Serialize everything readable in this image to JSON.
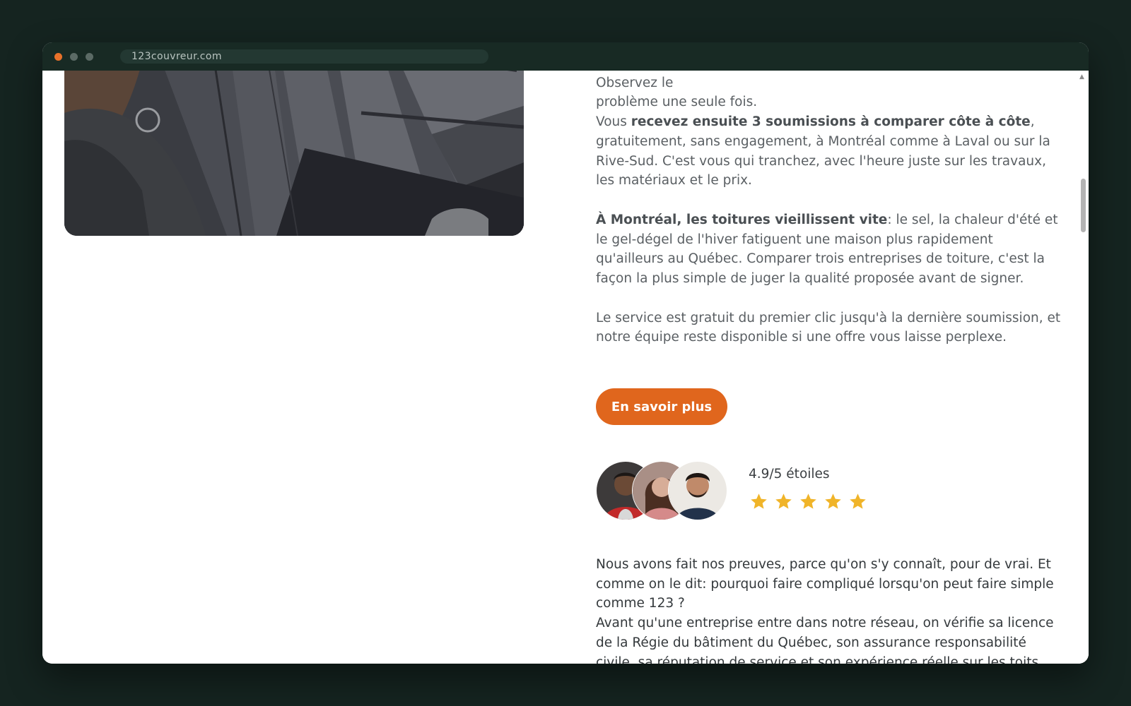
{
  "browser": {
    "url": "123couvreur.com"
  },
  "article": {
    "top_line": "perdent leurs granules, une pente qui retient l'eau après la pluie. Observez le",
    "line_end": "problème une seule fois.",
    "p1_start": "Vous ",
    "p1_bold": "recevez ensuite 3 soumissions à comparer côte à côte",
    "p1_rest": ", gratuitement, sans engagement, à Montréal comme à Laval ou sur la Rive-Sud. C'est vous qui tranchez, avec l'heure juste sur les travaux, les matériaux et le prix.",
    "p2_bold": "À Montréal, les toitures vieillissent vite",
    "p2_rest": ": le sel, la chaleur d'été et le gel-dégel de l'hiver fatiguent une maison plus rapidement qu'ailleurs au Québec. Comparer trois entreprises de toiture, c'est la façon la plus simple de juger la qualité proposée avant de signer.",
    "p3": "Le service est gratuit du premier clic jusqu'à la dernière soumission, et notre équipe reste disponible si une offre vous laisse perplexe."
  },
  "cta": {
    "label": "En savoir plus"
  },
  "rating": {
    "text": "4.9/5 étoiles",
    "stars": 5,
    "star_color": "#f0b429"
  },
  "bottom": {
    "p1": "Nous avons fait nos preuves, parce qu'on s'y connaît, pour de vrai. Et comme on le dit: pourquoi faire compliqué lorsqu'on peut faire simple comme 123 ?",
    "p2": "Avant qu'une entreprise entre dans notre réseau, on vérifie sa licence de la Régie du bâtiment du Québec, son assurance responsabilité civile, sa réputation de service et son expérience réelle sur les toits plats comme sur les toitures en bardeaux. C'est ce filtre qui fait la qualité du travail que vous recevrez."
  },
  "colors": {
    "accent": "#e0661d",
    "background": "#152420"
  }
}
